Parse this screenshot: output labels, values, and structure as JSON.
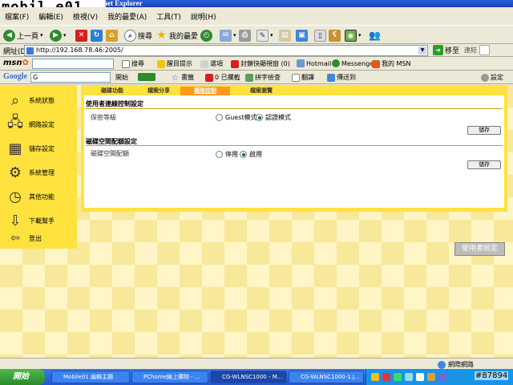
{
  "window": {
    "title_fragment": "ternet Explorer",
    "watermark_logo": "mobil e01",
    "watermark_number": "#87894"
  },
  "menu": [
    "檔案(F)",
    "編輯(E)",
    "檢視(V)",
    "我的最愛(A)",
    "工具(T)",
    "說明(H)"
  ],
  "toolbar": {
    "back": "上一頁",
    "search": "搜尋",
    "favorites": "我的最愛"
  },
  "address": {
    "label": "網址(D)",
    "url": "http://192.168.78.46:2005/",
    "go": "移至",
    "links": "連結"
  },
  "msnbar": {
    "logo": "msn",
    "search": "搜尋",
    "highlight": "醒目提示",
    "options": "選項",
    "popup": "封鎖快顯視窗 (0)",
    "hotmail": "Hotmail",
    "messenger": "Messenger",
    "my_msn": "我的 MSN"
  },
  "googlebar": {
    "logo": "Google",
    "input": "G",
    "start": "開始",
    "bookmarks": "書籤",
    "blocked": "0 已攔截",
    "spell": "拼字檢查",
    "translate": "翻譯",
    "send": "傳送到",
    "settings": "設定"
  },
  "sidebar": {
    "items": [
      {
        "label": "系統狀態",
        "icon": "magnifier-icon"
      },
      {
        "label": "網路設定",
        "icon": "network-icon"
      },
      {
        "label": "儲存設定",
        "icon": "storage-icon"
      },
      {
        "label": "系統管理",
        "icon": "gears-icon"
      },
      {
        "label": "其他功能",
        "icon": "clock-icon"
      },
      {
        "label": "下載幫手",
        "icon": "download-icon"
      },
      {
        "label": "登出",
        "icon": "logout-arrow-icon"
      }
    ]
  },
  "tabs": [
    {
      "label": "磁碟功能",
      "active": false
    },
    {
      "label": "檔案分享",
      "active": false
    },
    {
      "label": "權限控制",
      "active": true
    },
    {
      "label": "檔案瀏覽",
      "active": false
    }
  ],
  "sections": {
    "user_access": {
      "title": "使用者連線控制設定",
      "row_label": "保密等級",
      "option1": "Guest模式",
      "option2": "認證模式",
      "selected": "option2",
      "save": "儲存"
    },
    "quota": {
      "title": "磁碟空間配額設定",
      "row_label": "磁碟空間配額",
      "option1": "停用",
      "option2": "啟用",
      "selected": "option2",
      "save": "儲存"
    }
  },
  "user_setting_button": "使用者設定",
  "status": {
    "zone": "網際網路"
  },
  "taskbar": {
    "start": "開始",
    "tasks": [
      {
        "label": "Mobile01 編輯主題",
        "active": false
      },
      {
        "label": "PChome線上購物 - ...",
        "active": false
      },
      {
        "label": "CG-WLNSC1000 - M...",
        "active": true
      },
      {
        "label": "CG-WLNSC1000-1.J...",
        "active": false
      }
    ]
  }
}
